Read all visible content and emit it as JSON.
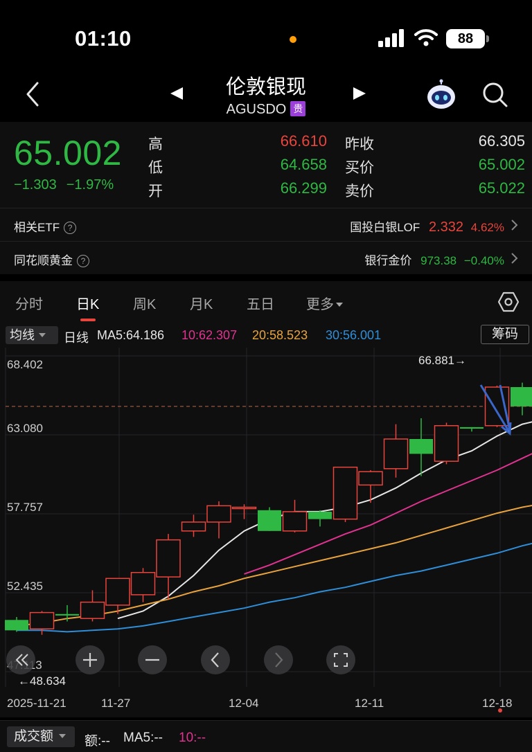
{
  "status_bar": {
    "time": "01:10",
    "battery": "88"
  },
  "header": {
    "title": "伦敦银现",
    "code": "AGUSDO",
    "badge": "贵"
  },
  "quote": {
    "price": "65.002",
    "change": "−1.303",
    "change_pct": "−1.97%",
    "stats": [
      {
        "label": "高",
        "value": "66.610",
        "tone": "up"
      },
      {
        "label": "低",
        "value": "64.658",
        "tone": "down"
      },
      {
        "label": "开",
        "value": "66.299",
        "tone": "down"
      },
      {
        "label": "昨收",
        "value": "66.305",
        "tone": "white"
      },
      {
        "label": "买价",
        "value": "65.002",
        "tone": "down"
      },
      {
        "label": "卖价",
        "value": "65.022",
        "tone": "down"
      }
    ]
  },
  "related_etf": {
    "label": "相关ETF",
    "name": "国投白银LOF",
    "price": "2.332",
    "pct": "4.62%"
  },
  "ths_gold": {
    "label": "同花顺黄金",
    "name": "银行金价",
    "price": "973.38",
    "pct": "−0.40%"
  },
  "tabs": [
    "分时",
    "日K",
    "周K",
    "月K",
    "五日",
    "更多"
  ],
  "active_tab": 1,
  "ma_bar": {
    "select": "均线",
    "period": "日线",
    "ma5": "MA5:64.186",
    "ma10": "10:62.307",
    "ma20": "20:58.523",
    "ma30": "30:56.001",
    "chip": "筹码"
  },
  "colors": {
    "up": "#e8453c",
    "down": "#2fb843",
    "ma5": "#e6e6e6",
    "ma10": "#e0338f",
    "ma20": "#e8a33c",
    "ma30": "#2f8ed8"
  },
  "chart_data": {
    "type": "candlestick",
    "y_ticks": [
      "68.402",
      "63.080",
      "57.757",
      "52.435",
      "47.113"
    ],
    "ylim": [
      47.113,
      68.402
    ],
    "x_ticks": [
      "2025-11-21",
      "11-27",
      "12-04",
      "12-11",
      "12-18"
    ],
    "max_label": "66.881→",
    "min_label": "←48.634",
    "last_close": 65.002,
    "candles": [
      {
        "o": 50.6,
        "h": 50.8,
        "l": 49.8,
        "c": 49.9
      },
      {
        "o": 50.0,
        "h": 51.2,
        "l": 49.6,
        "c": 51.1
      },
      {
        "o": 51.0,
        "h": 51.6,
        "l": 50.5,
        "c": 50.9
      },
      {
        "o": 50.7,
        "h": 52.6,
        "l": 50.5,
        "c": 51.8
      },
      {
        "o": 51.6,
        "h": 53.3,
        "l": 51.0,
        "c": 53.4
      },
      {
        "o": 52.3,
        "h": 54.1,
        "l": 51.8,
        "c": 53.8
      },
      {
        "o": 53.5,
        "h": 56.4,
        "l": 52.0,
        "c": 56.0
      },
      {
        "o": 56.6,
        "h": 57.7,
        "l": 56.2,
        "c": 57.2
      },
      {
        "o": 57.2,
        "h": 58.6,
        "l": 56.1,
        "c": 58.3
      },
      {
        "o": 58.2,
        "h": 58.4,
        "l": 57.4,
        "c": 58.2
      },
      {
        "o": 58.0,
        "h": 58.2,
        "l": 56.6,
        "c": 56.6
      },
      {
        "o": 56.6,
        "h": 58.7,
        "l": 56.5,
        "c": 57.9
      },
      {
        "o": 57.9,
        "h": 58.0,
        "l": 56.9,
        "c": 57.4
      },
      {
        "o": 57.4,
        "h": 60.9,
        "l": 57.2,
        "c": 60.9
      },
      {
        "o": 59.7,
        "h": 60.7,
        "l": 58.5,
        "c": 60.6
      },
      {
        "o": 60.8,
        "h": 63.8,
        "l": 60.2,
        "c": 62.8
      },
      {
        "o": 62.8,
        "h": 64.2,
        "l": 60.3,
        "c": 61.8
      },
      {
        "o": 61.3,
        "h": 63.9,
        "l": 61.1,
        "c": 63.7
      },
      {
        "o": 63.6,
        "h": 63.6,
        "l": 63.3,
        "c": 63.5
      },
      {
        "o": 63.7,
        "h": 66.4,
        "l": 63.6,
        "c": 66.3
      },
      {
        "o": 66.3,
        "h": 66.6,
        "l": 64.4,
        "c": 65.0
      },
      {
        "o": 65.0,
        "h": 66.2,
        "l": 63.2,
        "c": 66.0
      }
    ],
    "series": [
      {
        "name": "MA5",
        "values": [
          null,
          null,
          null,
          null,
          50.7,
          51.2,
          52.2,
          53.6,
          55.3,
          56.6,
          57.4,
          57.9,
          57.9,
          58.2,
          58.7,
          59.5,
          60.5,
          61.4,
          62.0,
          63.0,
          63.8,
          64.2
        ]
      },
      {
        "name": "MA10",
        "values": [
          null,
          null,
          null,
          null,
          null,
          null,
          null,
          null,
          null,
          53.7,
          54.3,
          55.0,
          55.7,
          56.4,
          57.0,
          57.8,
          58.6,
          59.3,
          60.0,
          60.7,
          61.5,
          62.3
        ]
      },
      {
        "name": "MA20",
        "values": [
          50.2,
          50.4,
          50.7,
          50.9,
          51.2,
          51.6,
          52.0,
          52.5,
          52.9,
          53.4,
          53.8,
          54.2,
          54.6,
          55.0,
          55.4,
          55.8,
          56.3,
          56.8,
          57.3,
          57.8,
          58.2,
          58.5
        ]
      },
      {
        "name": "MA30",
        "values": [
          49.9,
          49.9,
          49.8,
          49.9,
          50.0,
          50.2,
          50.5,
          50.8,
          51.1,
          51.4,
          51.8,
          52.1,
          52.5,
          52.8,
          53.2,
          53.6,
          53.9,
          54.3,
          54.7,
          55.1,
          55.6,
          56.0
        ]
      }
    ]
  },
  "volume_bar": {
    "select": "成交额",
    "amount": "额:--",
    "ma5": "MA5:--",
    "ma10": "10:--"
  }
}
